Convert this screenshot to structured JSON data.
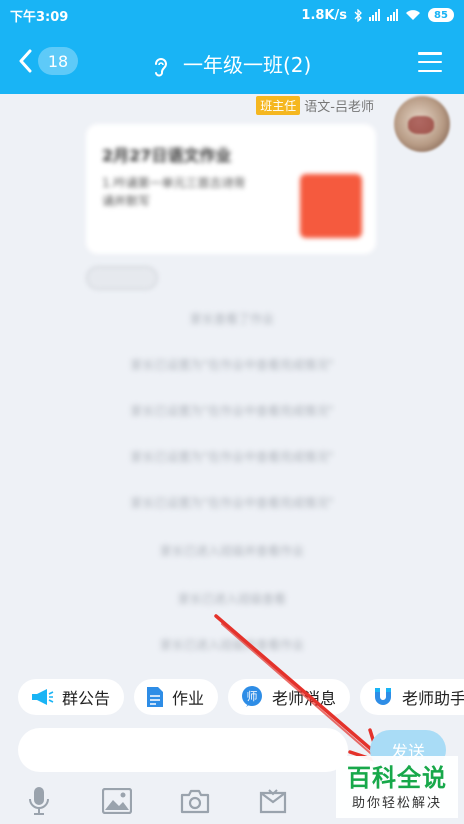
{
  "status_bar": {
    "time": "下午3:09",
    "speed": "1.8K/s",
    "battery": "85"
  },
  "title_bar": {
    "unread_count": "18",
    "title": "一年级一班(2)"
  },
  "message": {
    "role_tag": "班主任",
    "sender": "语文-吕老师",
    "card_title": "2月27日语文作业",
    "card_desc": "1.吟诵第一单元三首古诗背诵并默写"
  },
  "system_messages": [
    "家长查看了作业",
    "家长已设置为\"在作业中查看完成情况\"",
    "家长已设置为\"在作业中查看完成情况\"",
    "家长已设置为\"在作业中查看完成情况\"",
    "家长已设置为\"在作业中查看完成情况\"",
    "家长已进入班级并查看作业",
    "家长已进入班级查看",
    "家长已进入班级并查看作业"
  ],
  "quick_actions": [
    {
      "label": "群公告",
      "icon": "megaphone-icon",
      "color": "#19b4f5"
    },
    {
      "label": "作业",
      "icon": "document-icon",
      "color": "#2e8de6"
    },
    {
      "label": "老师消息",
      "icon": "teacher-icon",
      "color": "#2e8de6"
    },
    {
      "label": "老师助手",
      "icon": "magnet-icon",
      "color": "#2e8de6"
    }
  ],
  "composer": {
    "value": "",
    "send_label": "发送"
  },
  "toolbar": [
    "microphone-icon",
    "image-icon",
    "camera-icon",
    "gift-icon"
  ],
  "watermark": {
    "main": "百科全说",
    "sub": "助你轻松解决"
  }
}
